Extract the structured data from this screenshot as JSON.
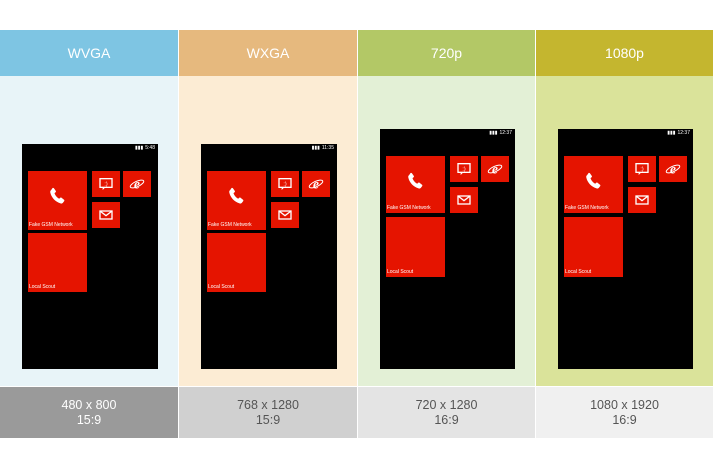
{
  "columns": [
    {
      "title": "WVGA",
      "resolution": "480 x 800",
      "ratio": "15:9",
      "time": "5:48",
      "header_color": "#7ec5e3",
      "body_color": "#e8f4f8",
      "footer_color": "#9a9a9a",
      "footer_text_color": "#ffffff",
      "tiles": {
        "phone_label": "Fake GSM Network",
        "scout_label": "Local Scout"
      }
    },
    {
      "title": "WXGA",
      "resolution": "768 x 1280",
      "ratio": "15:9",
      "time": "11:35",
      "header_color": "#e6b97e",
      "body_color": "#fcecd4",
      "footer_color": "#d0d0d0",
      "footer_text_color": "#555555",
      "tiles": {
        "phone_label": "Fake GSM Network",
        "scout_label": "Local Scout"
      }
    },
    {
      "title": "720p",
      "resolution": "720 x 1280",
      "ratio": "16:9",
      "time": "12:37",
      "header_color": "#b3c866",
      "body_color": "#e3f0d6",
      "footer_color": "#e4e4e4",
      "footer_text_color": "#555555",
      "tiles": {
        "phone_label": "Fake GSM Network",
        "scout_label": "Local Scout"
      }
    },
    {
      "title": "1080p",
      "resolution": "1080 x 1920",
      "ratio": "16:9",
      "time": "12:37",
      "header_color": "#c4b62f",
      "body_color": "#dae39a",
      "footer_color": "#f0f0f0",
      "footer_text_color": "#555555",
      "tiles": {
        "phone_label": "Fake GSM Network",
        "scout_label": "Local Scout"
      }
    }
  ],
  "icons": [
    "phone-icon",
    "messaging-icon",
    "internet-explorer-icon",
    "mail-icon",
    "signal-icon",
    "battery-icon"
  ]
}
